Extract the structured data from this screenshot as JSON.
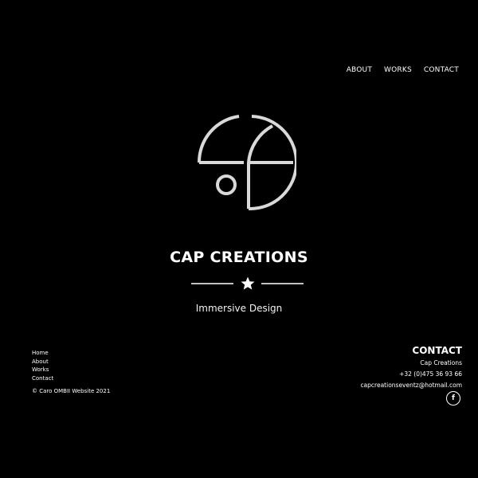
{
  "nav": {
    "items": [
      {
        "label": "ABOUT"
      },
      {
        "label": "WORKS"
      },
      {
        "label": "CONTACT"
      }
    ]
  },
  "hero": {
    "title": "CAP CREATIONS",
    "tagline": "Immersive Design",
    "logo_icon": "cap-creations-logo-icon",
    "divider_icon": "star-icon"
  },
  "footer": {
    "links": [
      {
        "label": "Home"
      },
      {
        "label": "About"
      },
      {
        "label": "Works"
      },
      {
        "label": "Contact"
      }
    ],
    "copyright": "© Caro OMBII Website 2021",
    "contact": {
      "heading": "CONTACT",
      "company": "Cap Creations",
      "phone": "+32 (0)475 36 93 66",
      "email": "capcreationseventz@hotmail.com",
      "social_icon": "facebook-icon",
      "social_glyph": "f"
    }
  },
  "colors": {
    "background": "#000000",
    "text": "#ffffff",
    "logo_stroke": "#d9d9d9"
  }
}
